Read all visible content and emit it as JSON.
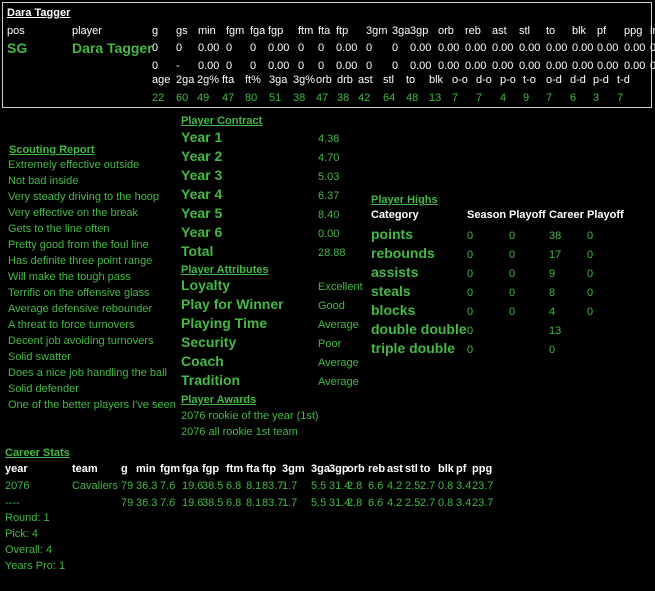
{
  "player_box": {
    "title": "Dara Tagger",
    "headers": [
      "pos",
      "player",
      "g",
      "gs",
      "min",
      "fgm",
      "fga",
      "fgp",
      "ftm",
      "fta",
      "ftp",
      "3gm",
      "3ga",
      "3gp",
      "orb",
      "reb",
      "ast",
      "stl",
      "to",
      "blk",
      "pf",
      "ppg",
      "inj"
    ],
    "pos": "SG",
    "name": "Dara Tagger",
    "row1": [
      "0",
      "0",
      "0.00",
      "0",
      "0",
      "0.00",
      "0",
      "0",
      "0.00",
      "0",
      "0",
      "0.00",
      "0.00",
      "0.00",
      "0.00",
      "0.00",
      "0.00",
      "0.00",
      "0.00",
      "0.00",
      "0"
    ],
    "row2": [
      "0",
      "-",
      "0.00",
      "0",
      "0",
      "0.00",
      "0",
      "0",
      "0.00",
      "0",
      "0",
      "0.00",
      "0.00",
      "0.00",
      "0.00",
      "0.00",
      "0.00",
      "0.00",
      "0.00",
      "0.00",
      "0"
    ],
    "rating_headers": [
      "age",
      "2ga",
      "2g%",
      "fta",
      "ft%",
      "3ga",
      "3g%",
      "orb",
      "drb",
      "ast",
      "stl",
      "to",
      "blk",
      "o-o",
      "d-o",
      "p-o",
      "t-o",
      "o-d",
      "d-d",
      "p-d",
      "t-d"
    ],
    "ratings": [
      "22",
      "60",
      "49",
      "47",
      "80",
      "51",
      "38",
      "47",
      "38",
      "42",
      "64",
      "48",
      "13",
      "7",
      "7",
      "4",
      "9",
      "7",
      "6",
      "3",
      "7"
    ]
  },
  "scouting": {
    "title": "Scouting Report",
    "items": [
      "Extremely effective outside",
      "Not bad inside",
      "Very steady driving to the hoop",
      "Very effective on the break",
      "Gets to the line often",
      "Pretty good from the foul line",
      "Has definite three point range",
      "Will make the tough pass",
      "Terrific on the offensive glass",
      "Average defensive rebounder",
      "A threat to force turnovers",
      "Decent job avoiding turnovers",
      "Solid swatter",
      "Does a nice job handling the ball",
      "Solid defender",
      "One of the better players I've seen"
    ]
  },
  "contract": {
    "title": "Player Contract",
    "rows": [
      {
        "label": "Year 1",
        "value": "4.38"
      },
      {
        "label": "Year 2",
        "value": "4.70"
      },
      {
        "label": "Year 3",
        "value": "5.03"
      },
      {
        "label": "Year 4",
        "value": "6.37"
      },
      {
        "label": "Year 5",
        "value": "8.40"
      },
      {
        "label": "Year 6",
        "value": "0.00"
      },
      {
        "label": "Total",
        "value": "28.88"
      }
    ]
  },
  "attributes": {
    "title": "Player Attributes",
    "rows": [
      {
        "label": "Loyalty",
        "value": "Excellent"
      },
      {
        "label": "Play for Winner",
        "value": "Good"
      },
      {
        "label": "Playing Time",
        "value": "Average"
      },
      {
        "label": "Security",
        "value": "Poor"
      },
      {
        "label": "Coach",
        "value": "Average"
      },
      {
        "label": "Tradition",
        "value": "Average"
      }
    ]
  },
  "awards": {
    "title": "Player Awards",
    "items": [
      "2076 rookie of the year (1st)",
      "2076 all rookie 1st team"
    ]
  },
  "highs": {
    "title": "Player Highs",
    "headers": [
      "Category",
      "Season",
      "Playoff",
      "Career",
      "Playoff"
    ],
    "rows": [
      {
        "label": "points",
        "season": "0",
        "playoff": "0",
        "career": "38",
        "cplayoff": "0"
      },
      {
        "label": "rebounds",
        "season": "0",
        "playoff": "0",
        "career": "17",
        "cplayoff": "0"
      },
      {
        "label": "assists",
        "season": "0",
        "playoff": "0",
        "career": "9",
        "cplayoff": "0"
      },
      {
        "label": "steals",
        "season": "0",
        "playoff": "0",
        "career": "8",
        "cplayoff": "0"
      },
      {
        "label": "blocks",
        "season": "0",
        "playoff": "0",
        "career": "4",
        "cplayoff": "0"
      },
      {
        "label": "double double",
        "season": "0",
        "playoff": "",
        "career": "13",
        "cplayoff": ""
      },
      {
        "label": "triple double",
        "season": "0",
        "playoff": "",
        "career": "0",
        "cplayoff": ""
      }
    ]
  },
  "career": {
    "title": "Career Stats",
    "headers": [
      "year",
      "team",
      "g",
      "min",
      "fgm",
      "fga",
      "fgp",
      "ftm",
      "fta",
      "ftp",
      "3gm",
      "3ga",
      "3gp",
      "orb",
      "reb",
      "ast",
      "stl",
      "to",
      "blk",
      "pf",
      "ppg"
    ],
    "rows": [
      [
        "2076",
        "Cavaliers",
        "79",
        "36.3",
        "7.6",
        "19.6",
        "38.5",
        "6.8",
        "8.1",
        "83.7",
        "1.7",
        "5.5",
        "31.4",
        "2.8",
        "6.6",
        "4.2",
        "2.5",
        "2.7",
        "0.8",
        "3.4",
        "23.7"
      ],
      [
        "----",
        "",
        "79",
        "36.3",
        "7.6",
        "19.6",
        "38.5",
        "6.8",
        "8.1",
        "83.7",
        "1.7",
        "5.5",
        "31.4",
        "2.8",
        "6.6",
        "4.2",
        "2.5",
        "2.7",
        "0.8",
        "3.4",
        "23.7"
      ]
    ],
    "draft": [
      "Round: 1",
      "Pick: 4",
      "Overall: 4",
      "Years Pro: 1"
    ]
  }
}
